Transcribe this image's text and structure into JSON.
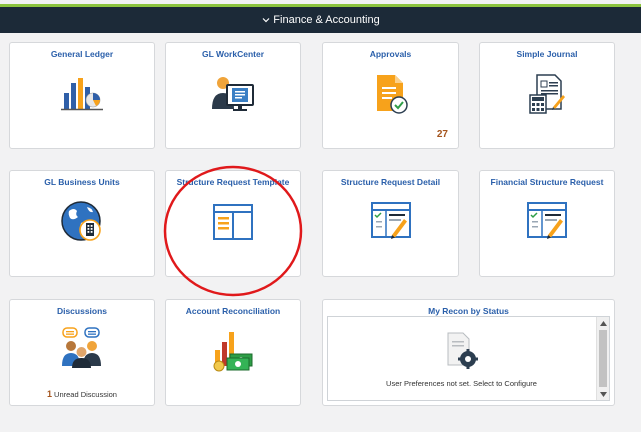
{
  "header": {
    "title": "Finance & Accounting",
    "chevron_icon": "chevron-down-icon"
  },
  "tiles": {
    "general_ledger": {
      "title": "General Ledger",
      "icon": "bar-pie-chart-icon"
    },
    "gl_workcenter": {
      "title": "GL WorkCenter",
      "icon": "person-monitor-icon"
    },
    "approvals": {
      "title": "Approvals",
      "icon": "document-checkmark-icon",
      "badge": "27"
    },
    "simple_journal": {
      "title": "Simple Journal",
      "icon": "journal-calculator-icon"
    },
    "gl_business_units": {
      "title": "GL Business Units",
      "icon": "globe-building-icon"
    },
    "structure_request_template": {
      "title": "Structure Request Template",
      "icon": "template-layout-icon"
    },
    "structure_request_detail": {
      "title": "Structure Request Detail",
      "icon": "checklist-pencil-icon"
    },
    "financial_structure_request": {
      "title": "Financial Structure Request",
      "icon": "checklist-pencil-icon"
    },
    "discussions": {
      "title": "Discussions",
      "icon": "people-chat-icon",
      "count": "1",
      "count_label": "Unread Discussion"
    },
    "account_reconciliation": {
      "title": "Account Reconciliation",
      "icon": "bars-money-icon"
    },
    "my_recon_by_status": {
      "title": "My Recon by Status",
      "icon": "document-gear-icon",
      "message": "User Preferences not set. Select to Configure"
    }
  },
  "colors": {
    "header_bg": "#1c2a38",
    "accent_bar": "#8cc43f",
    "tile_title": "#2a5faa",
    "badge": "#a4551e",
    "annotation": "#e0191b"
  }
}
